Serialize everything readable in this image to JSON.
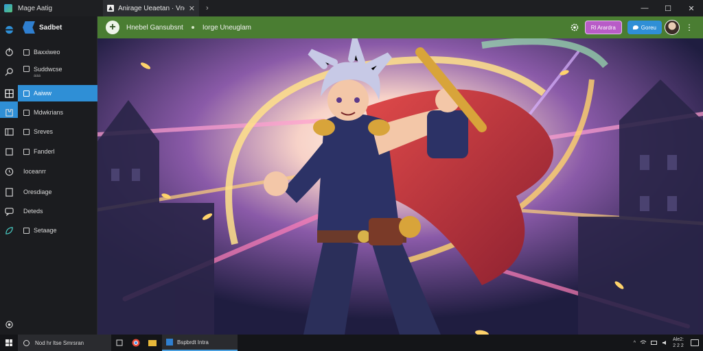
{
  "window": {
    "app_name": "Mage Aatig",
    "tab_title": "Anirage Ueaetan · Vneal"
  },
  "sidebar": {
    "brand": "Sadbet",
    "items": [
      {
        "label": "Baxxiweo",
        "sub": ""
      },
      {
        "label": "Suddwcse",
        "sub": "aaa"
      },
      {
        "label": "Aaiww",
        "sub": ""
      },
      {
        "label": "Mdwkrians",
        "sub": ""
      },
      {
        "label": "Sreves",
        "sub": ""
      },
      {
        "label": "Fanderl",
        "sub": ""
      },
      {
        "label": "Ioceanrr",
        "sub": ""
      },
      {
        "label": "Oresdiage",
        "sub": ""
      },
      {
        "label": "Deteds",
        "sub": ""
      },
      {
        "label": "Setaage",
        "sub": ""
      }
    ],
    "active_index": 2
  },
  "toolbar": {
    "title": "Hnebel Gansubsnt",
    "subtitle": "Iorge Uneuglam",
    "purple_label": "Rl Arardra",
    "blue_label": "Goreu"
  },
  "taskbar": {
    "search_placeholder": "Nod hr ltse Smrsran",
    "app_label": "Bspbrdt Intra",
    "time": "Ale2:",
    "date": "2 2 2"
  },
  "colors": {
    "accent": "#2f8fd6",
    "green_bar": "#4a7d32",
    "purple_pill": "#b85cc7"
  }
}
